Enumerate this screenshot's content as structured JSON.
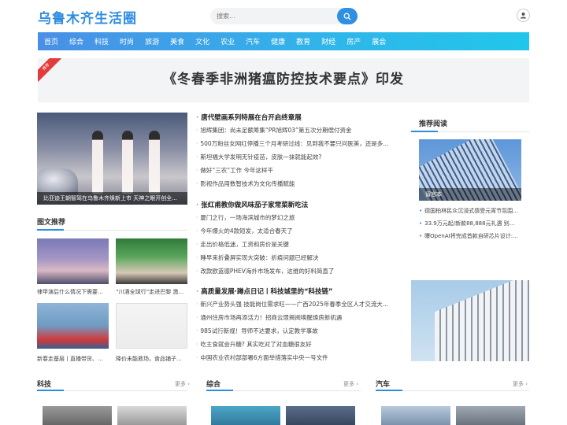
{
  "site": {
    "logo": "乌鲁木齐生活圈"
  },
  "search": {
    "placeholder": "搜索..."
  },
  "nav": [
    "首页",
    "综合",
    "科技",
    "时尚",
    "旅游",
    "美食",
    "文化",
    "农业",
    "汽车",
    "健康",
    "教育",
    "财经",
    "房产",
    "展会"
  ],
  "banner": {
    "ribbon": "推荐",
    "title": "《冬春季非洲猪瘟防控技术要点》印发"
  },
  "hero": {
    "caption": "比亚迪王朝智驾在乌鲁木齐焕新上市 天神之眼开创全..."
  },
  "graphics": {
    "title": "图文推荐",
    "items": [
      {
        "caption": "律甲演后什么情况下需要..."
      },
      {
        "caption": "“川酒全球行”走进巴黎 激..."
      },
      {
        "caption": "新春走基层丨直播带货、..."
      },
      {
        "caption": "降价未能救场，食品铺子..."
      }
    ]
  },
  "news_groups": [
    {
      "headline": "唐代壁画系列特展在台开启终章展",
      "items": [
        "旭辉集团：尚未足额筹集“PR旭辉03”第五次分期偿付资金",
        "500万粉丝女网红停播三个月考研过线：见到我不要只问医美，还是多...",
        "斯坦福大学发明无针疫苗，皮肤一抹就能起效?",
        "做好“三农”工作 今年这样干",
        "影视作品用数智技术为文化传播赋能"
      ]
    },
    {
      "headline": "张红甫教你做风味茄子家常菜新吃法",
      "items": [
        "厦门之行，一场海滨城市的梦幻之旅",
        "今年爆火的4款短发，太适合春天了",
        "走出价格低迷，工资和房价是关键",
        "睡早来折叠屏实现大突破：折痕问题已经解决",
        "改款欧蓝德PHEV海外市场发布，这维的好料简直了"
      ]
    },
    {
      "headline": "高质量发展·蹲点日记丨科技城里的“科技链”",
      "items": [
        "新兴产业势头强 技能岗位需求旺——广西2025年春季全区人才交流大...",
        "通州住房市场再添活力！招商云璟揭阅唤醒焕房新机遇",
        "985试行新规！导师不达要求，认定教学事故",
        "吃主食就会升糖? 其实吃对了对血糖很友好",
        "中国农业农村部部署6方面举措落实中央一号文件"
      ]
    }
  ],
  "recommend": {
    "title": "推荐阅读",
    "image_caption": "留言本",
    "items": [
      "德国柏林民众沉浸式感受元宵节氛围...",
      "33.9万元起/新款88,888元礼遇 别...",
      "曝OpenAI将完成首款自研芯片设计:..."
    ]
  },
  "bottom_sections": [
    {
      "title": "科技",
      "more": "更多 ›"
    },
    {
      "title": "综合",
      "more": "更多 ›"
    },
    {
      "title": "汽车",
      "more": "更多 ›"
    }
  ],
  "colors": {
    "brand": "#2e8ce0",
    "nav_start": "#4a8fe6",
    "nav_end": "#22c6ea",
    "ribbon": "#e23b3b"
  },
  "icons": {
    "search": "search-icon",
    "user": "user-icon"
  }
}
